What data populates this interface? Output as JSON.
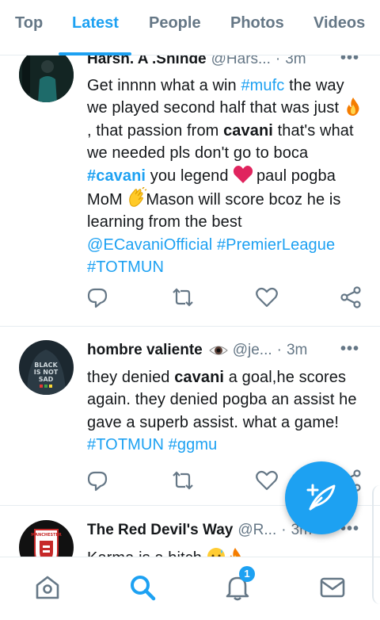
{
  "tabs": [
    {
      "label": "Top"
    },
    {
      "label": "Latest"
    },
    {
      "label": "People"
    },
    {
      "label": "Photos"
    },
    {
      "label": "Videos"
    }
  ],
  "active_tab": "Latest",
  "tweets": [
    {
      "display_name": "Harsh. A .Shinde",
      "handle": "@Hars...",
      "time": "3m",
      "segments": [
        {
          "t": "Get innnn what a win "
        },
        {
          "t": "#mufc",
          "s": "tag"
        },
        {
          "t": " the way we played second half that was just "
        },
        {
          "e": "fire"
        },
        {
          "t": ", that passion from "
        },
        {
          "t": "cavani",
          "s": "bold"
        },
        {
          "t": " that's what we needed pls don't go to boca "
        },
        {
          "t": "#cavani",
          "s": "tagbold"
        },
        {
          "t": " you legend "
        },
        {
          "e": "heart"
        },
        {
          "t": " paul pogba MoM "
        },
        {
          "e": "clap"
        },
        {
          "t": "Mason will score bcoz he is learning from the best "
        },
        {
          "t": "@ECavaniOfficial",
          "s": "tag"
        },
        {
          "t": " "
        },
        {
          "t": "#PremierLeague",
          "s": "tag"
        },
        {
          "t": " "
        },
        {
          "t": "#TOTMUN",
          "s": "tag"
        }
      ]
    },
    {
      "display_name": "hombre valiente",
      "name_emoji": "eye",
      "handle": "@je...",
      "time": "3m",
      "avatar_text": "BLACK IS NOT SAD",
      "segments": [
        {
          "t": "they denied "
        },
        {
          "t": "cavani",
          "s": "bold"
        },
        {
          "t": " a goal,he scores again. they denied pogba an assist he gave a superb assist. what a game! "
        },
        {
          "t": "#TOTMUN",
          "s": "tag"
        },
        {
          "t": " "
        },
        {
          "t": "#ggmu",
          "s": "tag"
        }
      ]
    },
    {
      "display_name": "The Red Devil's Way",
      "handle": "@R...",
      "time": "3m",
      "avatar_text": "MANCHESTER",
      "segments": [
        {
          "t": "Karma is a bitch "
        },
        {
          "e": "sweat"
        },
        {
          "e": "fire"
        }
      ]
    }
  ],
  "bottom_nav": {
    "notifications_count": "1"
  },
  "icons": {
    "reply": "reply-icon",
    "retweet": "retweet-icon",
    "like": "heart-icon",
    "share": "share-icon",
    "home": "home-icon",
    "search": "search-icon",
    "notifications": "bell-icon",
    "messages": "mail-icon",
    "compose": "compose-tweet-icon",
    "more": "more-dots-icon"
  },
  "colors": {
    "accent": "#1da1f2",
    "text": "#14171a",
    "secondary": "#657786"
  }
}
